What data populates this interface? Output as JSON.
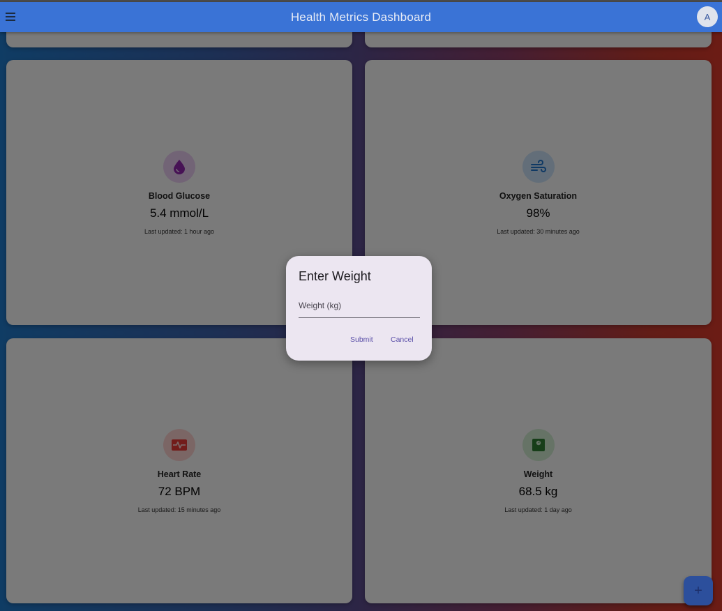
{
  "header": {
    "title": "Health Metrics Dashboard",
    "avatar_initial": "A"
  },
  "cards": [
    {
      "name": "Blood Glucose",
      "value": "5.4 mmol/L",
      "updated": "Last updated: 1 hour ago",
      "icon": "water-drop-icon",
      "color": "#8e24aa"
    },
    {
      "name": "Oxygen Saturation",
      "value": "98%",
      "updated": "Last updated: 30 minutes ago",
      "icon": "air-icon",
      "color": "#1e73c8"
    },
    {
      "name": "Heart Rate",
      "value": "72 BPM",
      "updated": "Last updated: 15 minutes ago",
      "icon": "monitor-heart-icon",
      "color": "#e53935"
    },
    {
      "name": "Weight",
      "value": "68.5 kg",
      "updated": "Last updated: 1 day ago",
      "icon": "scale-icon",
      "color": "#2e7d32"
    }
  ],
  "dialog": {
    "title": "Enter Weight",
    "field_label": "Weight (kg)",
    "submit_label": "Submit",
    "cancel_label": "Cancel"
  },
  "fab": {
    "icon": "plus-icon",
    "label": "+"
  }
}
